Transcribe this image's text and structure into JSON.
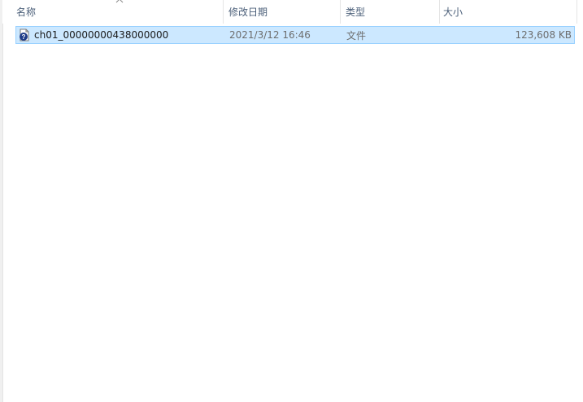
{
  "columns": {
    "name": "名称",
    "modified": "修改日期",
    "type": "类型",
    "size": "大小"
  },
  "sort": {
    "column": "name",
    "direction": "ascending",
    "icon": "chevron-up-icon"
  },
  "files": [
    {
      "name": "ch01_00000000438000000",
      "modified": "2021/3/12 16:46",
      "type": "文件",
      "size": "123,608 KB",
      "icon": "unknown-file-icon",
      "selected": true
    }
  ],
  "colors": {
    "selection_bg": "#cce8ff",
    "selection_border": "#99d1ff",
    "header_text": "#4c607a",
    "secondary_text": "#6d6d6d"
  }
}
